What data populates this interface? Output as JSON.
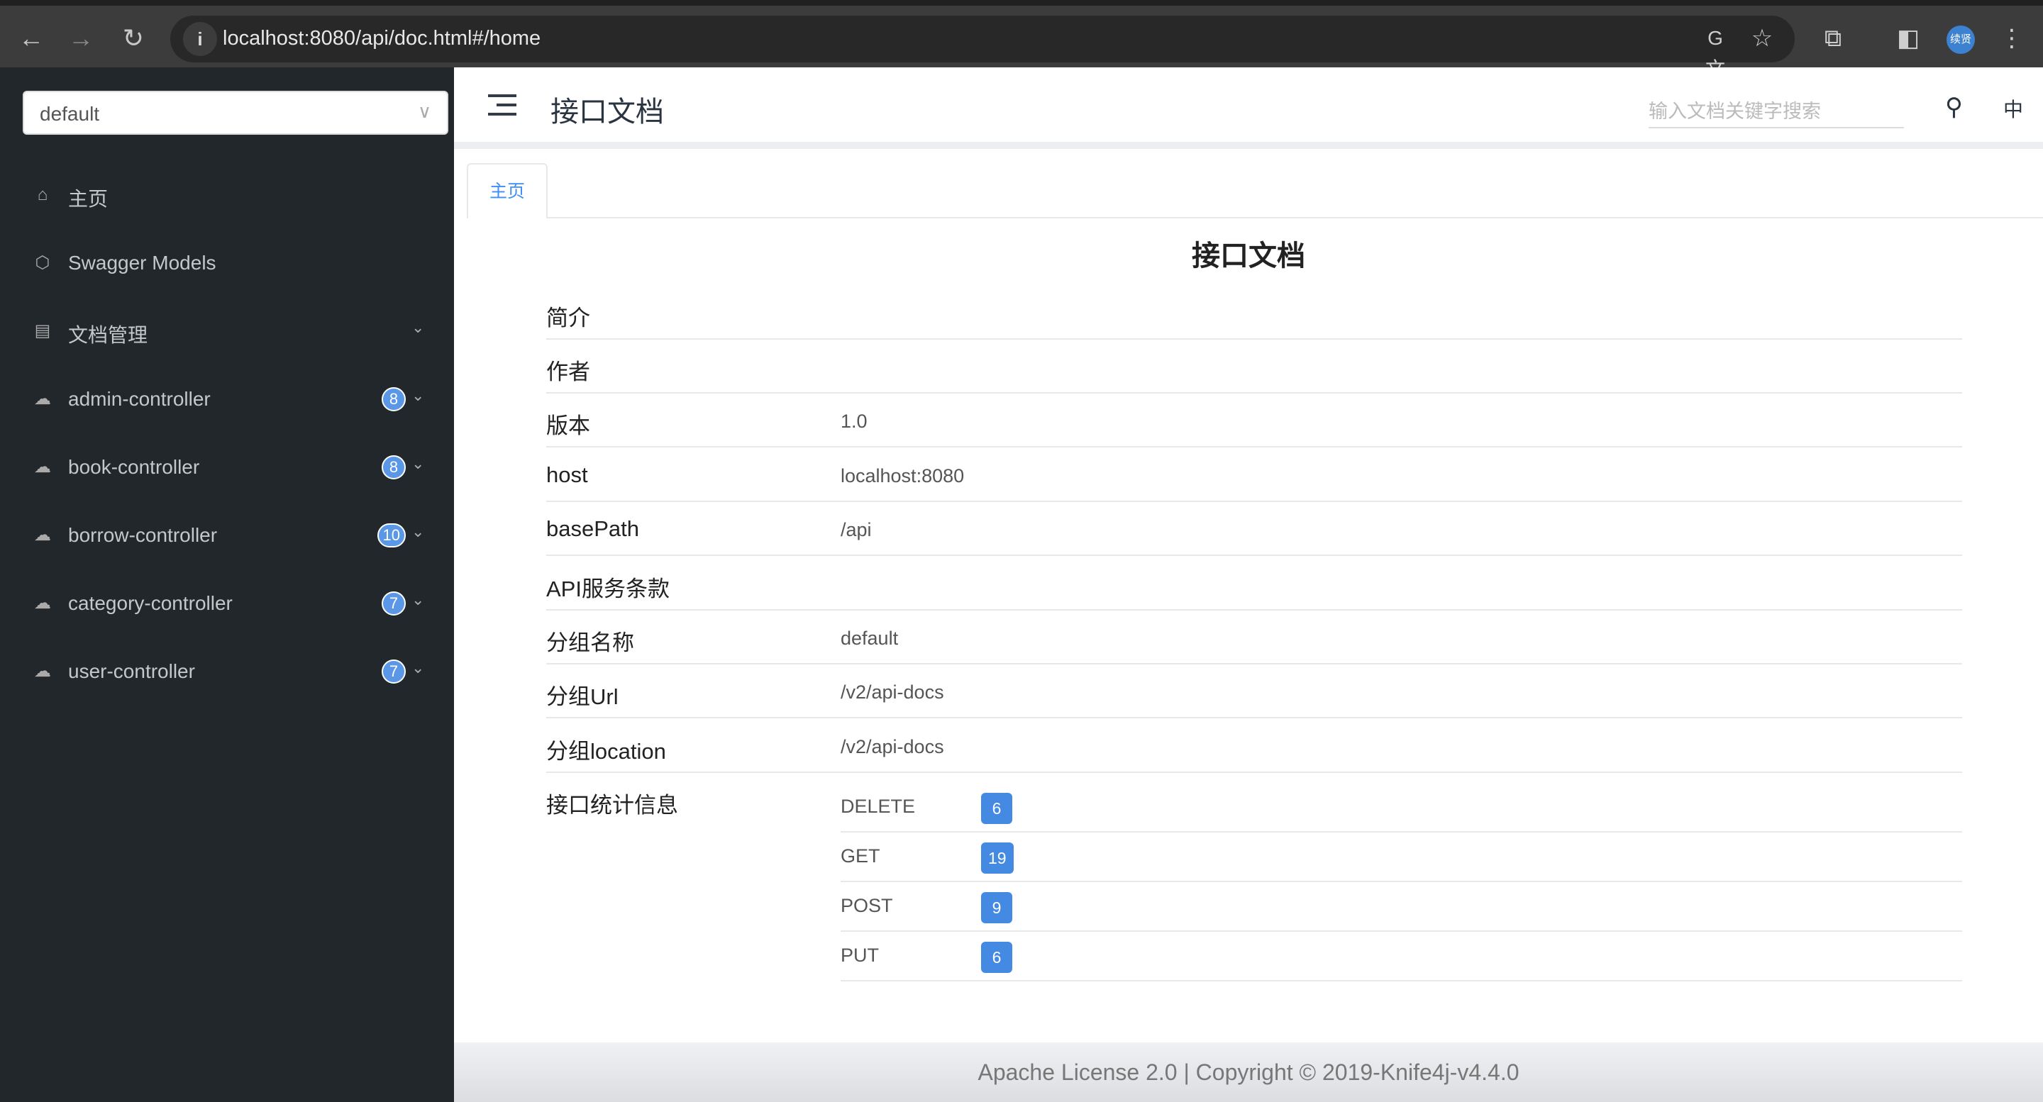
{
  "browser": {
    "url": "localhost:8080/api/doc.html#/home",
    "avatar_text": "续贤"
  },
  "sidebar": {
    "group_select": "default",
    "items": [
      {
        "label": "主页",
        "icon": "home-icon"
      },
      {
        "label": "Swagger Models",
        "icon": "models-icon"
      },
      {
        "label": "文档管理",
        "icon": "doc-settings-icon"
      },
      {
        "label": "admin-controller",
        "badge": "8",
        "icon": "api-cloud-icon"
      },
      {
        "label": "book-controller",
        "badge": "8",
        "icon": "api-cloud-icon"
      },
      {
        "label": "borrow-controller",
        "badge": "10",
        "icon": "api-cloud-icon"
      },
      {
        "label": "category-controller",
        "badge": "7",
        "icon": "api-cloud-icon"
      },
      {
        "label": "user-controller",
        "badge": "7",
        "icon": "api-cloud-icon"
      }
    ]
  },
  "header": {
    "title": "接口文档",
    "search_placeholder": "输入文档关键字搜索",
    "lang": "中"
  },
  "tabs": [
    {
      "label": "主页"
    }
  ],
  "main": {
    "title": "接口文档",
    "rows": [
      {
        "k": "简介",
        "v": ""
      },
      {
        "k": "作者",
        "v": ""
      },
      {
        "k": "版本",
        "v": "1.0"
      },
      {
        "k": "host",
        "v": "localhost:8080"
      },
      {
        "k": "basePath",
        "v": "/api"
      },
      {
        "k": "API服务条款",
        "v": ""
      },
      {
        "k": "分组名称",
        "v": "default"
      },
      {
        "k": "分组Url",
        "v": "/v2/api-docs"
      },
      {
        "k": "分组location",
        "v": "/v2/api-docs"
      }
    ],
    "stats_label": "接口统计信息",
    "stats": [
      {
        "m": "DELETE",
        "n": "6"
      },
      {
        "m": "GET",
        "n": "19"
      },
      {
        "m": "POST",
        "n": "9"
      },
      {
        "m": "PUT",
        "n": "6"
      }
    ]
  },
  "footer": "Apache License 2.0 | Copyright © 2019-Knife4j-v4.4.0",
  "colors": {
    "sidebar": "#21272b",
    "accent": "#3e8ef7",
    "badge": "#448ae2"
  }
}
